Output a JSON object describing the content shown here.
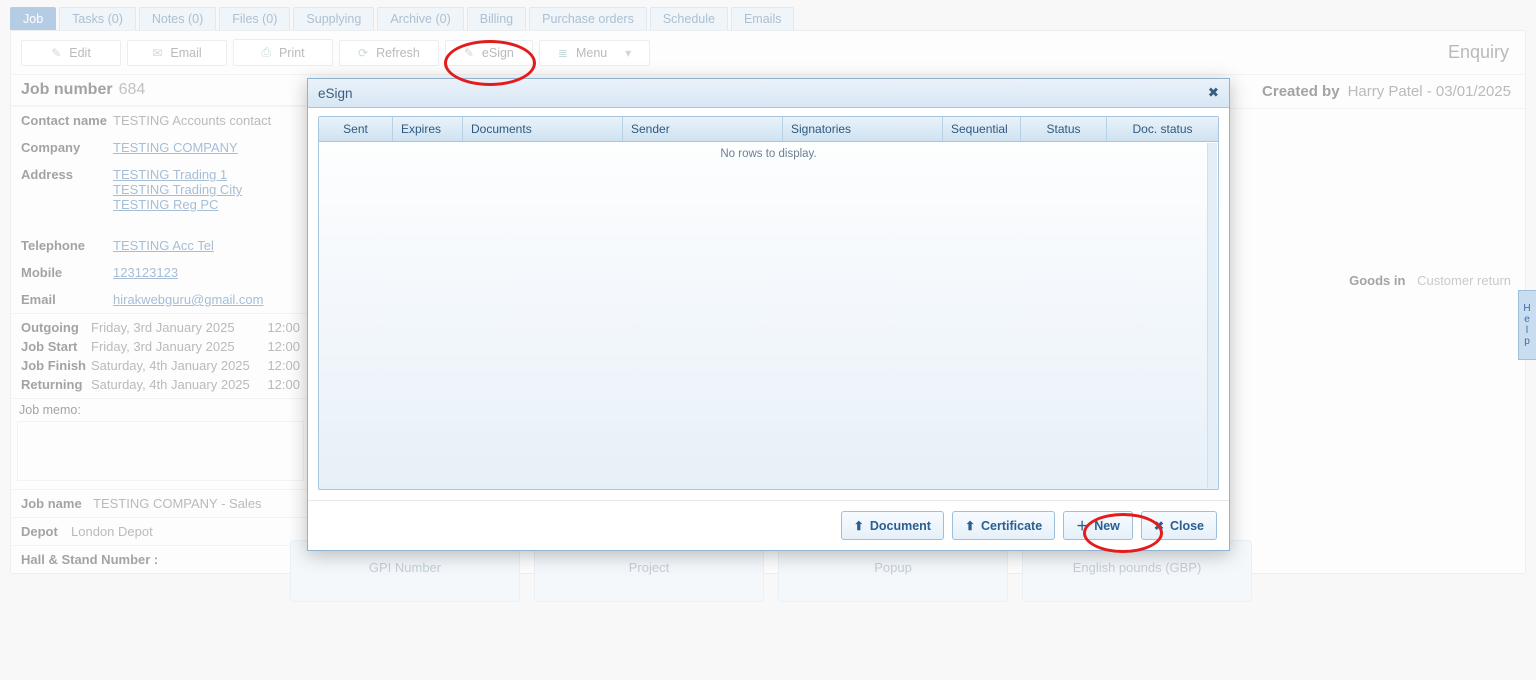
{
  "tabs": [
    "Job",
    "Tasks (0)",
    "Notes (0)",
    "Files (0)",
    "Supplying",
    "Archive (0)",
    "Billing",
    "Purchase orders",
    "Schedule",
    "Emails"
  ],
  "active_tab_index": 0,
  "toolbar": {
    "edit": "Edit",
    "email": "Email",
    "print": "Print",
    "refresh": "Refresh",
    "esign": "eSign",
    "menu": "Menu"
  },
  "page_mode": "Enquiry",
  "job": {
    "number_label": "Job number",
    "number": "684",
    "contact_label": "Contact name",
    "contact": "TESTING Accounts contact",
    "company_label": "Company",
    "company": "TESTING COMPANY",
    "address_label": "Address",
    "address_lines": [
      "TESTING Trading 1",
      "TESTING Trading City",
      "TESTING Reg PC"
    ],
    "telephone_label": "Telephone",
    "telephone": "TESTING Acc Tel",
    "mobile_label": "Mobile",
    "mobile": "123123123",
    "email_label": "Email",
    "email": "hirakwebguru@gmail.com",
    "dates": [
      {
        "label": "Outgoing",
        "value": "Friday, 3rd January 2025",
        "time": "12:00"
      },
      {
        "label": "Job Start",
        "value": "Friday, 3rd January 2025",
        "time": "12:00"
      },
      {
        "label": "Job Finish",
        "value": "Saturday, 4th January 2025",
        "time": "12:00"
      },
      {
        "label": "Returning",
        "value": "Saturday, 4th January 2025",
        "time": "12:00"
      }
    ],
    "memo_label": "Job memo:",
    "jobname_label": "Job name",
    "jobname": "TESTING COMPANY - Sales",
    "depot_label": "Depot",
    "depot": "London Depot",
    "hall_label": "Hall & Stand Number :"
  },
  "created": {
    "label": "Created by",
    "value": "Harry Patel - 03/01/2025"
  },
  "goods": {
    "label": "Goods in",
    "value": "Customer return"
  },
  "help_tab": "Help",
  "cards": [
    "GPI Number",
    "Project",
    "Popup",
    "English pounds (GBP)"
  ],
  "modal": {
    "title": "eSign",
    "columns": [
      "Sent",
      "Expires",
      "Documents",
      "Sender",
      "Signatories",
      "Sequential",
      "Status",
      "Doc. status"
    ],
    "empty": "No rows to display.",
    "buttons": {
      "document": "Document",
      "certificate": "Certificate",
      "new": "New",
      "close": "Close"
    }
  }
}
